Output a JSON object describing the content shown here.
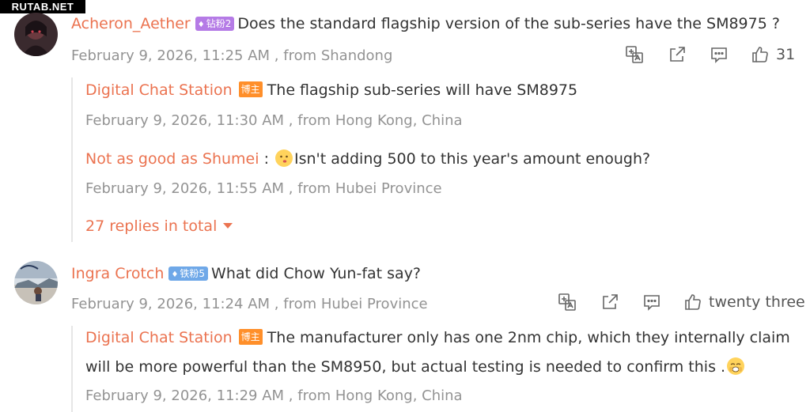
{
  "watermark": "RUTAB.NET",
  "comments": [
    {
      "username": "Acheron_Aether",
      "badge": "钻粉2",
      "text": "Does the standard flagship version of the sub-series have the SM8975 ?",
      "meta": "February 9, 2026, 11:25 AM , from Shandong",
      "likes": "31",
      "replies": [
        {
          "username": "Digital Chat Station",
          "badge": "博主",
          "text": "The flagship sub-series will have SM8975",
          "meta": "February 9, 2026, 11:30 AM , from Hong Kong, China"
        },
        {
          "username": "Not as good as Shumei",
          "separator": " : ",
          "text": "Isn't adding 500 to this year's amount enough?",
          "meta": "February 9, 2026, 11:55 AM , from Hubei Province"
        }
      ],
      "more_replies": "27 replies in total"
    },
    {
      "username": "Ingra Crotch",
      "badge": "铁粉5",
      "text": "What did Chow Yun-fat say?",
      "meta": "February 9, 2026, 11:24 AM , from Hubei Province",
      "likes": "twenty three",
      "replies": [
        {
          "username": "Digital Chat Station",
          "badge": "博主",
          "text_line1": "The manufacturer only has one 2nm chip, which they internally claim",
          "text_line2": "will be more powerful than the SM8950, but actual testing is needed to confirm this .",
          "meta": "February 9, 2026, 11:29 AM , from Hong Kong, China"
        }
      ]
    }
  ],
  "icons": {
    "translate": "translate-icon",
    "share": "share-icon",
    "comment": "comment-icon",
    "like": "like-icon"
  },
  "colors": {
    "username": "#eb7350",
    "meta": "#939393",
    "host_badge": "#ff8f2a",
    "diamond_badge": "#b57be6",
    "iron_badge": "#6fa8e8"
  }
}
